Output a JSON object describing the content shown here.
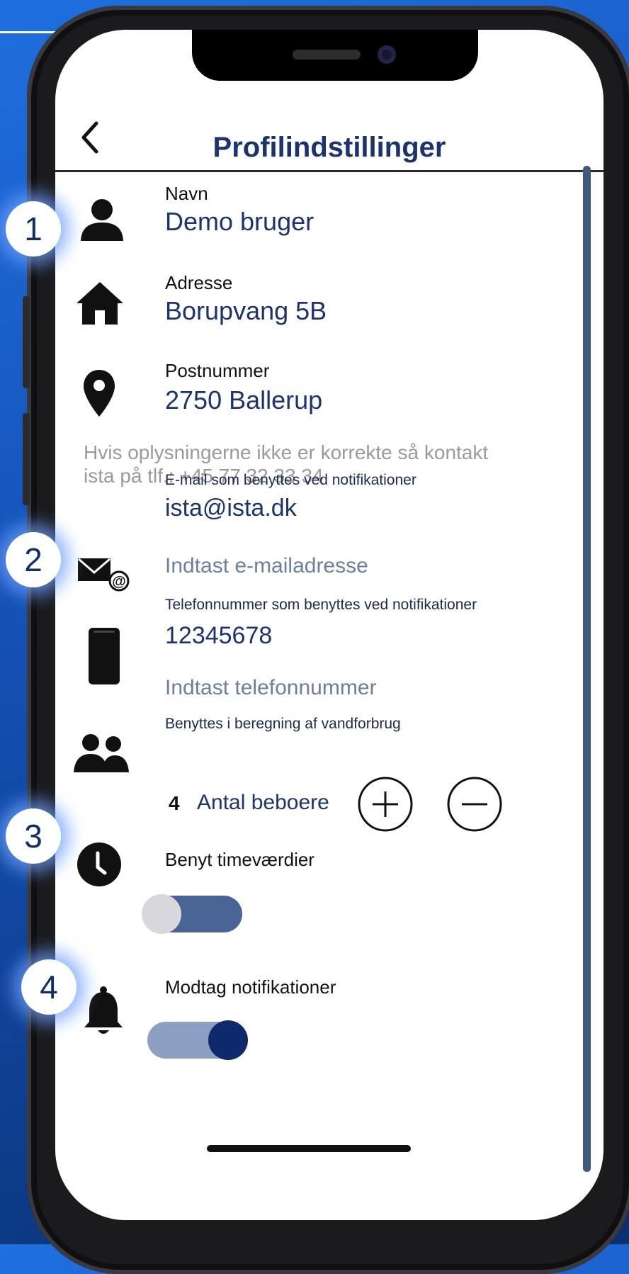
{
  "header": {
    "title": "Profilindstillinger",
    "back_icon": "chevron-left-icon"
  },
  "profile": {
    "name_label": "Navn",
    "name_value": "Demo bruger",
    "address_label": "Adresse",
    "address_value": "Borupvang 5B",
    "postal_label": "Postnummer",
    "postal_value": "2750 Ballerup",
    "note_line1": "Hvis oplysningerne ikke er korrekte så kontakt",
    "note_line2": "ista på tlf.:  +45 77 32 33 34"
  },
  "notifications": {
    "email_label": "E-mail som benyttes ved notifikationer",
    "email_value": "ista@ista.dk",
    "email_placeholder": "Indtast e-mailadresse",
    "phone_label": "Telefonnummer som benyttes ved notifikationer",
    "phone_value": "12345678",
    "phone_placeholder": "Indtast telefonnummer"
  },
  "residents": {
    "label": "Benyttes i beregning af vandforbrug",
    "count": "4",
    "count_label": "Antal beboere",
    "plus_icon": "plus-circle-icon",
    "minus_icon": "minus-circle-icon"
  },
  "toggles": {
    "hourly_label": "Benyt timeværdier",
    "hourly_on": false,
    "notify_label": "Modtag notifikationer",
    "notify_on": true
  },
  "badges": [
    "1",
    "2",
    "3",
    "4"
  ],
  "colors": {
    "accent": "#1b3470",
    "toggle_track_off": "#4a6495",
    "toggle_track_on": "#8da0c4",
    "toggle_knob_on": "#0f2a6b",
    "background": "#1553b8"
  }
}
